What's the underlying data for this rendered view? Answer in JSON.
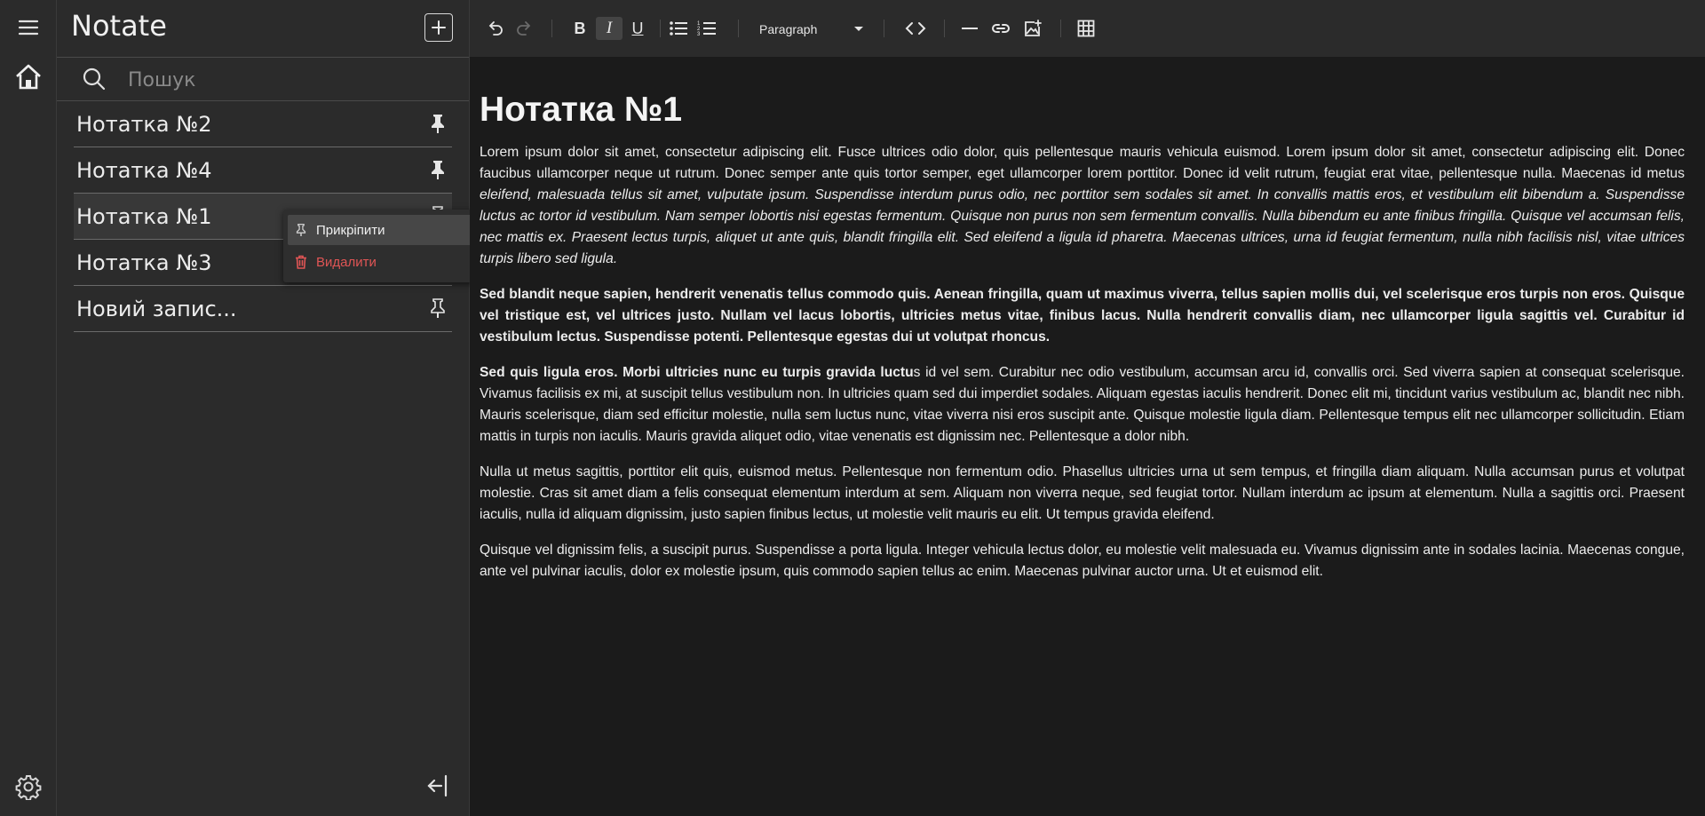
{
  "app": {
    "title": "Notate"
  },
  "search": {
    "placeholder": "Пошук"
  },
  "notes": [
    {
      "title": "Нотатка №2",
      "pinned": true
    },
    {
      "title": "Нотатка №4",
      "pinned": true
    },
    {
      "title": "Нотатка №1",
      "pinned": false,
      "active": true
    },
    {
      "title": "Нотатка №3",
      "pinned": false
    },
    {
      "title": "Новий запис...",
      "pinned": false
    }
  ],
  "context_menu": {
    "pin_label": "Прикріпити",
    "delete_label": "Видалити"
  },
  "toolbar": {
    "block_type": "Paragraph",
    "icons": [
      "undo-icon",
      "redo-icon",
      "bold-icon",
      "italic-icon",
      "underline-icon",
      "bullet-list-icon",
      "numbered-list-icon",
      "code-icon",
      "horizontal-rule-icon",
      "link-icon",
      "image-icon",
      "table-icon"
    ]
  },
  "document": {
    "title": "Нотатка №1",
    "p1": "Lorem ipsum dolor sit amet, consectetur adipiscing elit. Fusce ultrices odio dolor, quis pellentesque mauris vehicula euismod. Lorem ipsum dolor sit amet, consectetur adipiscing elit. Donec faucibus ullamcorper neque ut rutrum. Donec semper ante quis tortor semper, eget ullamcorper lorem porttitor. Donec id velit rutrum, feugiat erat vitae, pellentesque nulla. Maecenas id metus",
    "p1_italic": "eleifend, malesuada tellus sit amet, vulputate ipsum. Suspendisse interdum purus odio, nec porttitor sem sodales sit amet. In convallis mattis eros, et vestibulum elit bibendum a. Suspendisse luctus ac tortor id vestibulum. Nam semper lobortis nisi egestas fermentum. Quisque non purus non sem fermentum convallis. Nulla bibendum eu ante finibus fringilla. Quisque vel accumsan felis, nec mattis ex. Praesent lectus turpis, aliquet ut ante quis, blandit fringilla elit. Sed eleifend a ligula id pharetra. Maecenas ultrices, urna id feugiat fermentum, nulla nibh facilisis nisl, vitae ultrices turpis libero sed ligula.",
    "p2_bold": "Sed blandit neque sapien, hendrerit venenatis tellus commodo quis. Aenean fringilla, quam ut maximus viverra, tellus sapien mollis dui, vel scelerisque eros turpis non eros. Quisque vel tristique est, vel ultrices justo. Nullam vel lacus lobortis, ultricies metus vitae, finibus lacus. Nulla hendrerit convallis diam, nec ullamcorper ligula sagittis vel. Curabitur id vestibulum lectus. Suspendisse potenti. Pellentesque egestas dui ut volutpat rhoncus.",
    "p3_bold": "Sed quis ligula eros. Morbi ultricies nunc eu turpis gravida luctu",
    "p3": "s id vel sem. Curabitur nec odio vestibulum, accumsan arcu id, convallis orci. Sed viverra sapien at consequat scelerisque. Vivamus facilisis ex mi, at suscipit tellus vestibulum non. In ultricies quam sed dui imperdiet sodales. Aliquam egestas iaculis hendrerit. Donec elit mi, tincidunt varius vestibulum ac, blandit nec nibh. Mauris scelerisque, diam sed efficitur molestie, nulla sem luctus nunc, vitae viverra nisi eros suscipit ante. Quisque molestie ligula diam. Pellentesque tempus elit nec ullamcorper sollicitudin. Etiam mattis in turpis non iaculis. Mauris gravida aliquet odio, vitae venenatis est dignissim nec. Pellentesque a dolor nibh.",
    "p4": "Nulla ut metus sagittis, porttitor elit quis, euismod metus. Pellentesque non fermentum odio. Phasellus ultricies urna ut sem tempus, et fringilla diam aliquam. Nulla accumsan purus et volutpat molestie. Cras sit amet diam a felis consequat elementum interdum at sem. Aliquam non viverra neque, sed feugiat tortor. Nullam interdum ac ipsum at elementum. Nulla a sagittis orci. Praesent iaculis, nulla id aliquam dignissim, justo sapien finibus lectus, ut molestie velit mauris eu elit. Ut tempus gravida eleifend.",
    "p5": "Quisque vel dignissim felis, a suscipit purus. Suspendisse a porta ligula. Integer vehicula lectus dolor, eu molestie velit malesuada eu. Vivamus dignissim ante in sodales lacinia. Maecenas congue, ante vel pulvinar iaculis, dolor ex molestie ipsum, quis commodo sapien tellus ac enim. Maecenas pulvinar auctor urna. Ut et euismod elit."
  },
  "colors": {
    "background": "#1b1b1b",
    "panel": "#2b2b2b",
    "delete": "#e05555"
  }
}
